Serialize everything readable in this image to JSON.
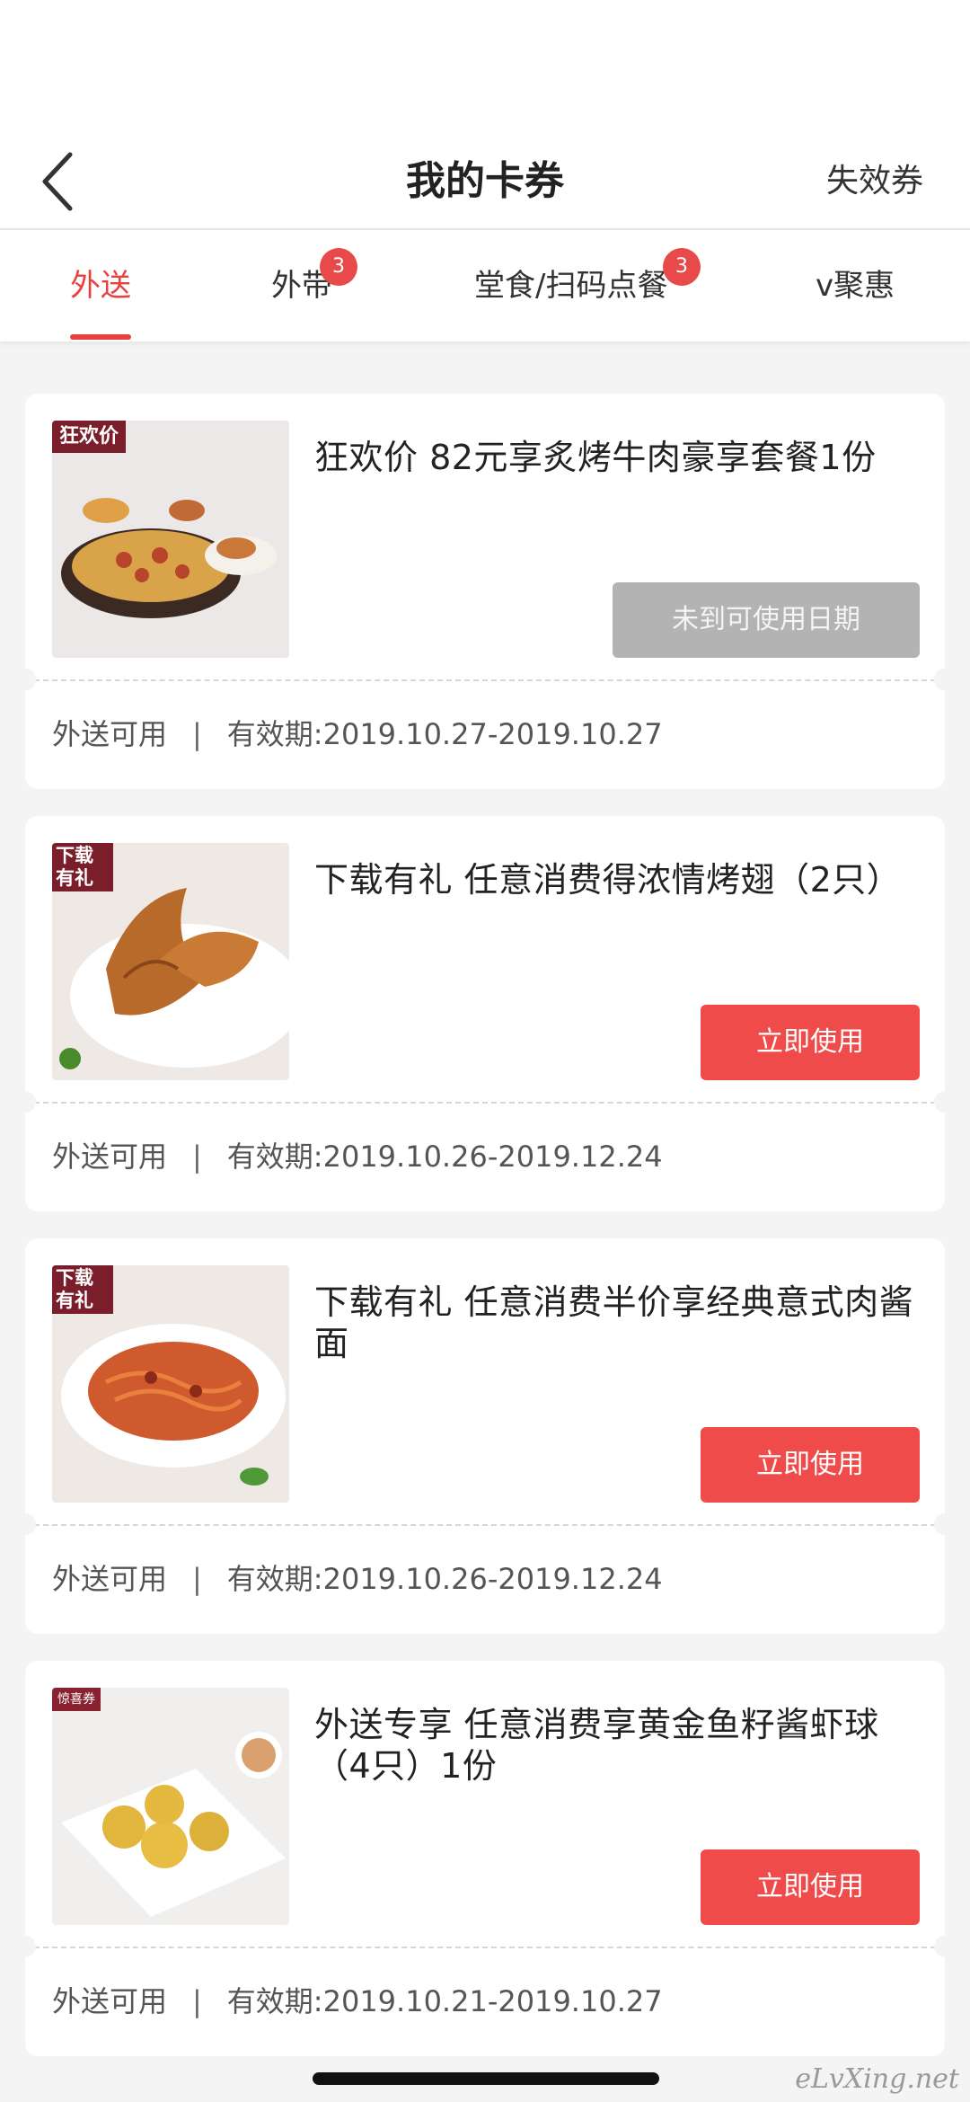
{
  "nav": {
    "title": "我的卡券",
    "expired_label": "失效券"
  },
  "tabs": [
    {
      "label": "外送",
      "active": true
    },
    {
      "label": "外带",
      "badge": "3"
    },
    {
      "label": "堂食/扫码点餐",
      "badge": "3"
    },
    {
      "label": "v聚惠"
    }
  ],
  "coupons": [
    {
      "tag": "狂欢价",
      "title": "狂欢价 82元享炙烤牛肉豪享套餐1份",
      "button": "未到可使用日期",
      "button_enabled": false,
      "scope": "外送可用",
      "separator": "|",
      "validity_label": "有效期:",
      "validity": "2019.10.27-2019.10.27"
    },
    {
      "tag": "下载有礼",
      "title": "下载有礼 任意消费得浓情烤翅（2只）",
      "button": "立即使用",
      "button_enabled": true,
      "scope": "外送可用",
      "separator": "|",
      "validity_label": "有效期:",
      "validity": "2019.10.26-2019.12.24"
    },
    {
      "tag": "下载有礼",
      "title": "下载有礼 任意消费半价享经典意式肉酱面",
      "button": "立即使用",
      "button_enabled": true,
      "scope": "外送可用",
      "separator": "|",
      "validity_label": "有效期:",
      "validity": "2019.10.26-2019.12.24"
    },
    {
      "tag": "惊喜券",
      "title": "外送专享 任意消费享黄金鱼籽酱虾球（4只）1份",
      "button": "立即使用",
      "button_enabled": true,
      "scope": "外送可用",
      "separator": "|",
      "validity_label": "有效期:",
      "validity": "2019.10.21-2019.10.27"
    }
  ],
  "watermark": "eLvXing.net",
  "colors": {
    "accent": "#e64340",
    "button": "#f04b4b",
    "disabled": "#b3b3b3"
  }
}
